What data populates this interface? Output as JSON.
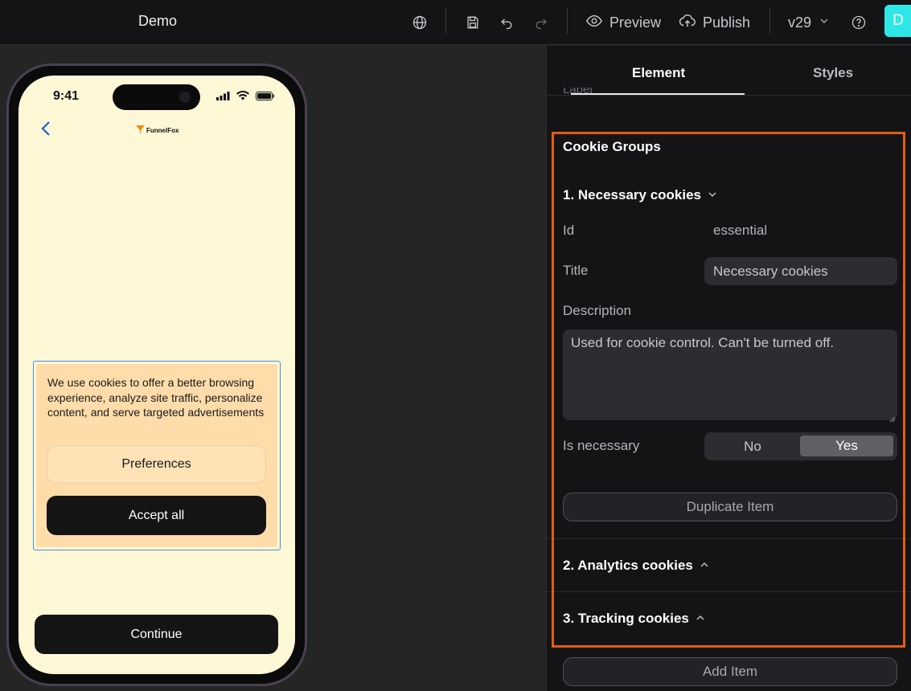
{
  "app": {
    "title": "Demo",
    "version": "v29",
    "avatar_letter": "D",
    "accent": "#2ee8e8",
    "highlight_color": "#e35d0c"
  },
  "toolbar": {
    "preview_label": "Preview",
    "publish_label": "Publish"
  },
  "phone": {
    "time": "9:41",
    "logo_text": "FunnelFox",
    "background": "#fff8d6",
    "cookie_banner": {
      "text": "We use cookies to offer a better browsing experience, analyze site traffic, personalize content, and serve targeted advertisements",
      "preferences_label": "Preferences",
      "accept_label": "Accept all"
    },
    "continue_label": "Continue"
  },
  "panel": {
    "tabs": [
      {
        "label": "Element"
      },
      {
        "label": "Styles"
      }
    ],
    "label_peek": "Label",
    "section_title": "Cookie Groups",
    "groups": [
      {
        "title": "1. Necessary cookies",
        "expanded": true
      },
      {
        "title": "2. Analytics cookies",
        "expanded": false
      },
      {
        "title": "3. Tracking cookies",
        "expanded": false
      }
    ],
    "fields": {
      "id_label": "Id",
      "id_value": "essential",
      "title_label": "Title",
      "title_value": "Necessary cookies",
      "description_label": "Description",
      "description_value": "Used for cookie control. Can't be turned off.",
      "necessary_label": "Is necessary",
      "toggle_no": "No",
      "toggle_yes": "Yes",
      "selected": "Yes"
    },
    "duplicate_label": "Duplicate Item",
    "add_label": "Add Item"
  }
}
